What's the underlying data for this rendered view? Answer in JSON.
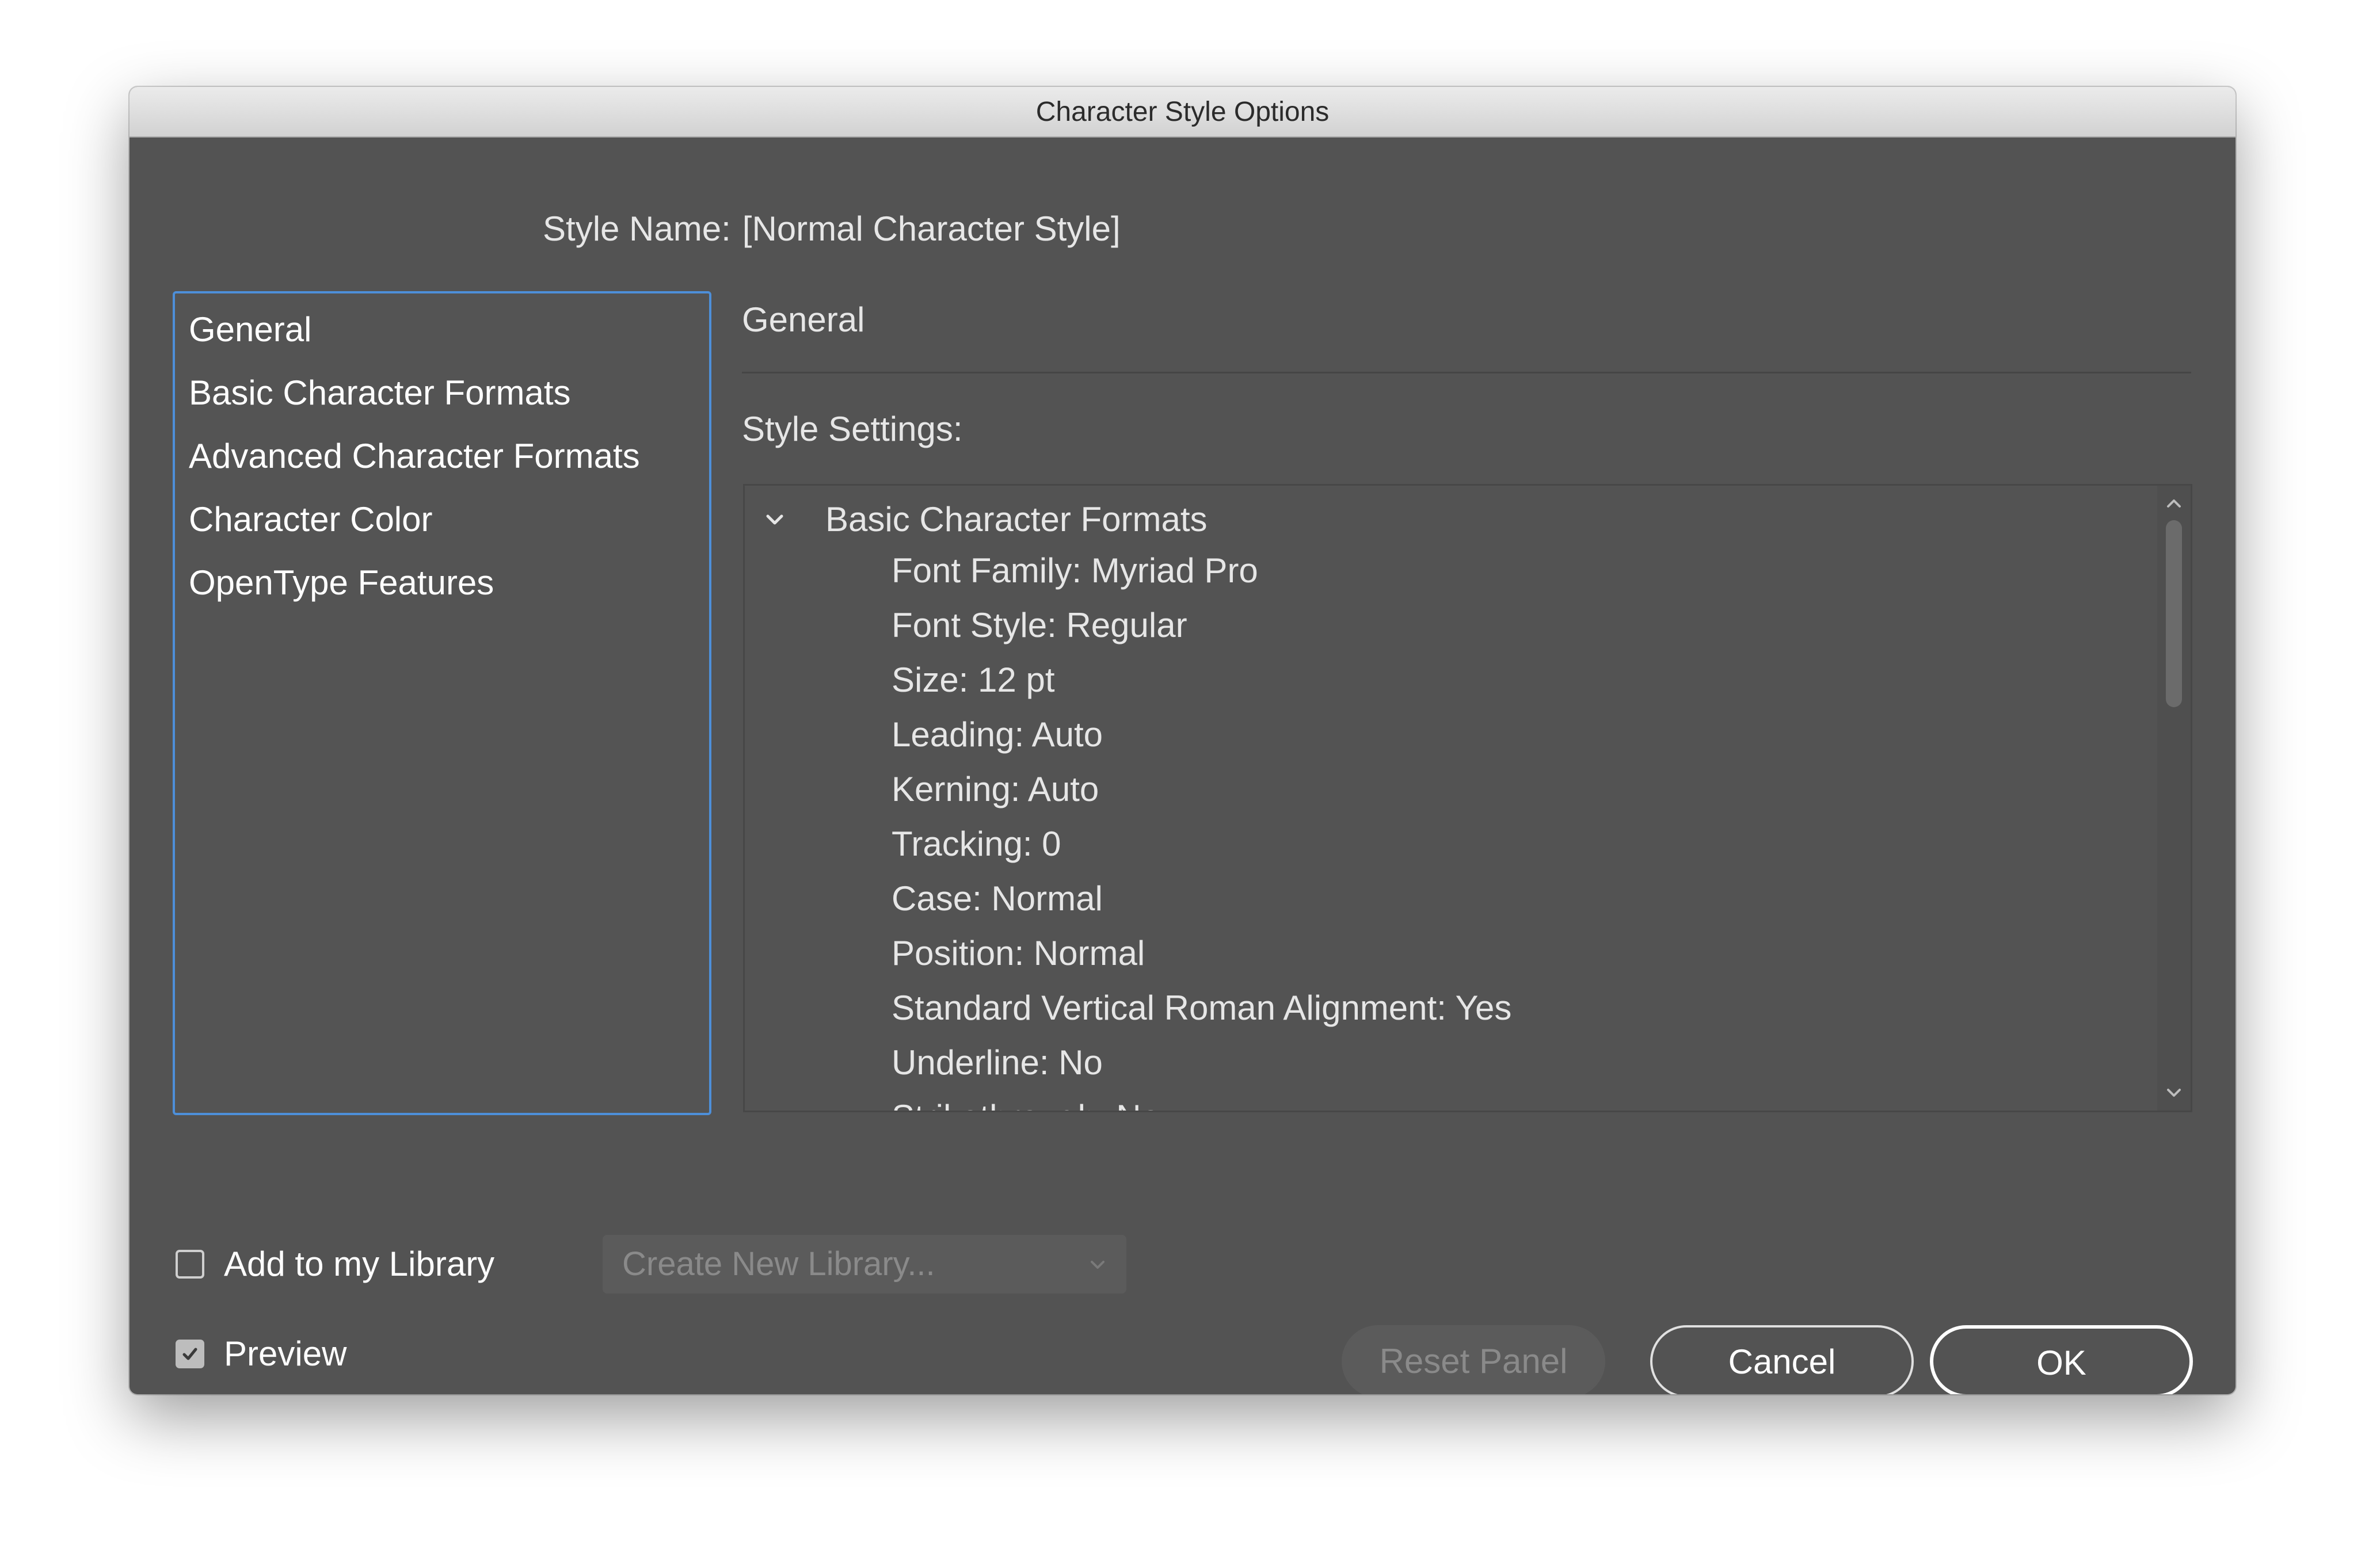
{
  "window": {
    "title": "Character Style Options"
  },
  "style_name": {
    "label": "Style Name:",
    "value": "[Normal Character Style]"
  },
  "sidebar": {
    "items": [
      {
        "label": "General"
      },
      {
        "label": "Basic Character Formats"
      },
      {
        "label": "Advanced Character Formats"
      },
      {
        "label": "Character Color"
      },
      {
        "label": "OpenType Features"
      }
    ]
  },
  "main": {
    "section_title": "General",
    "settings_label": "Style Settings:",
    "tree": {
      "group_label": "Basic Character Formats",
      "expanded": true,
      "items": [
        "Font Family: Myriad Pro",
        "Font Style: Regular",
        "Size: 12 pt",
        "Leading: Auto",
        "Kerning: Auto",
        "Tracking: 0",
        "Case: Normal",
        "Position: Normal",
        "Standard Vertical Roman Alignment: Yes",
        "Underline: No",
        "Strikethrough: No"
      ]
    }
  },
  "library": {
    "checkbox_label": "Add to my Library",
    "checked": false,
    "select_value": "Create New Library..."
  },
  "preview": {
    "checkbox_label": "Preview",
    "checked": true
  },
  "buttons": {
    "reset": "Reset Panel",
    "cancel": "Cancel",
    "ok": "OK"
  },
  "icons": {
    "tree_toggle": "chevron-down-icon",
    "scroll_up": "chevron-up-icon",
    "scroll_down": "chevron-down-icon",
    "select_caret": "chevron-down-icon",
    "preview_check": "checkmark-icon"
  },
  "colors": {
    "dialog_bg": "#535353",
    "focus_ring": "#4d8fd9",
    "text": "#e6e6e6",
    "disabled_text": "#8a8a8a"
  }
}
